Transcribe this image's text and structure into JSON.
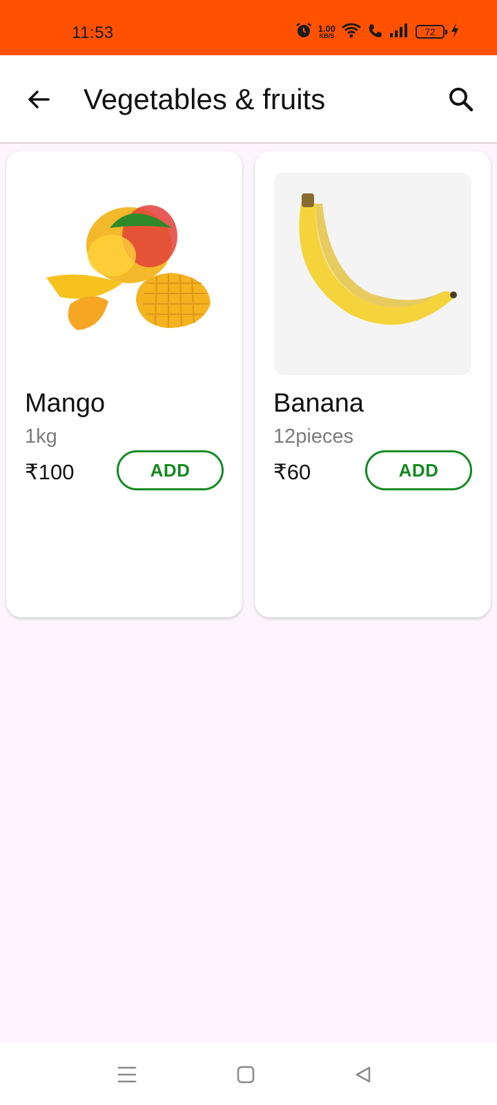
{
  "status_bar": {
    "time": "11:53",
    "net_speed_value": "1.00",
    "net_speed_unit": "KB/S",
    "battery": "72",
    "icons": [
      "alarm-icon",
      "wifi-icon",
      "call-icon",
      "signal-icon",
      "battery-icon",
      "charging-icon"
    ]
  },
  "app_bar": {
    "title": "Vegetables & fruits",
    "back_icon": "arrow-left-icon",
    "search_icon": "search-icon"
  },
  "products": [
    {
      "name": "Mango",
      "quantity": "1kg",
      "price": "₹100",
      "add_label": "ADD",
      "image_pages": 2,
      "active_page": 0
    },
    {
      "name": "Banana",
      "quantity": "12pieces",
      "price": "₹60",
      "add_label": "ADD",
      "image_pages": 3,
      "active_page": 0
    }
  ],
  "nav_bar": {
    "icons": [
      "menu-icon",
      "home-icon",
      "back-triangle-icon"
    ]
  },
  "colors": {
    "status_bar": "#ff5100",
    "accent_green": "#128a1f",
    "page_background": "#fcf5fd"
  }
}
